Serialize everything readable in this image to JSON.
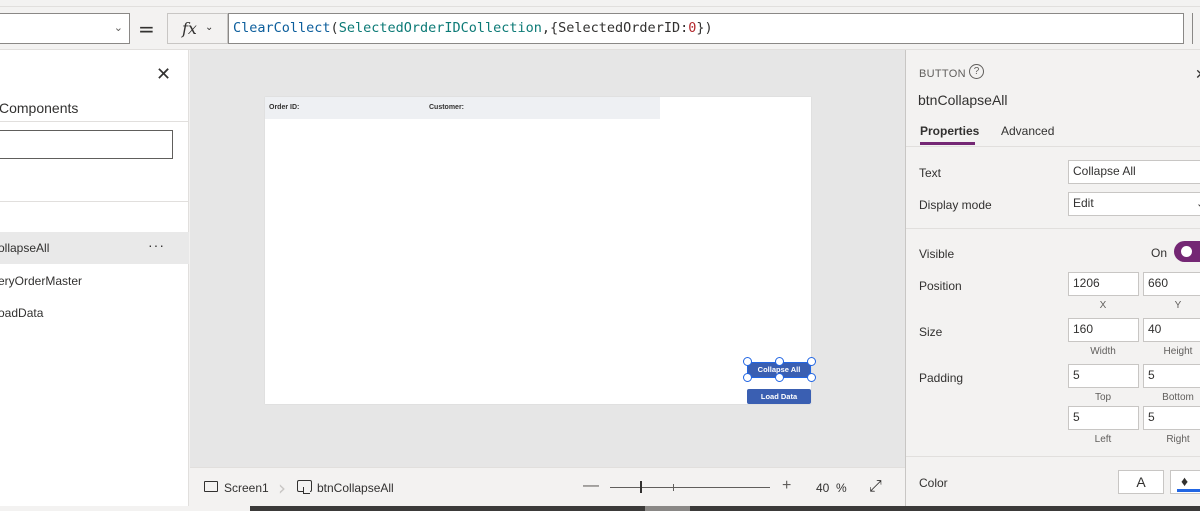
{
  "formula_bar": {
    "equals": "=",
    "fx_label": "fx",
    "formula_parts": {
      "fn": "ClearCollect",
      "p1": "(",
      "collection": "SelectedOrderIDCollection",
      "p2": ",{",
      "field": "SelectedOrderID",
      "p3": ":",
      "number": "0",
      "p4": "})"
    }
  },
  "tree_view": {
    "title": "Components",
    "items": [
      {
        "label": "ollapseAll",
        "selected": true
      },
      {
        "label": "eryOrderMaster",
        "selected": false
      },
      {
        "label": "oadData",
        "selected": false
      }
    ],
    "more_label": "···"
  },
  "canvas": {
    "gallery_header": {
      "order_id_label": "Order ID:",
      "customer_label": "Customer:"
    },
    "collapse_button_label": "Collapse All",
    "load_button_label": "Load Data"
  },
  "status_bar": {
    "screen_label": "Screen1",
    "selected_control": "btnCollapseAll",
    "zoom_value": "40",
    "zoom_unit": "%",
    "zoom_level_percent": 40
  },
  "properties_panel": {
    "control_type": "BUTTON",
    "control_name": "btnCollapseAll",
    "tabs": {
      "properties": "Properties",
      "advanced": "Advanced"
    },
    "text_label": "Text",
    "text_value": "Collapse All",
    "display_mode_label": "Display mode",
    "display_mode_value": "Edit",
    "visible_label": "Visible",
    "visible_state": "On",
    "position_label": "Position",
    "position_x": "1206",
    "position_y": "660",
    "x_label": "X",
    "y_label": "Y",
    "size_label": "Size",
    "size_width": "160",
    "size_height": "40",
    "width_label": "Width",
    "height_label": "Height",
    "padding_label": "Padding",
    "padding_top": "5",
    "padding_bottom": "5",
    "padding_left": "5",
    "padding_right": "5",
    "top_label": "Top",
    "bottom_label": "Bottom",
    "left_label": "Left",
    "right_label": "Right",
    "color_label": "Color",
    "color_text_glyph": "A",
    "accent_color": "#742774",
    "selection_color": "#2266e3",
    "button_color": "#3a5fb2"
  }
}
